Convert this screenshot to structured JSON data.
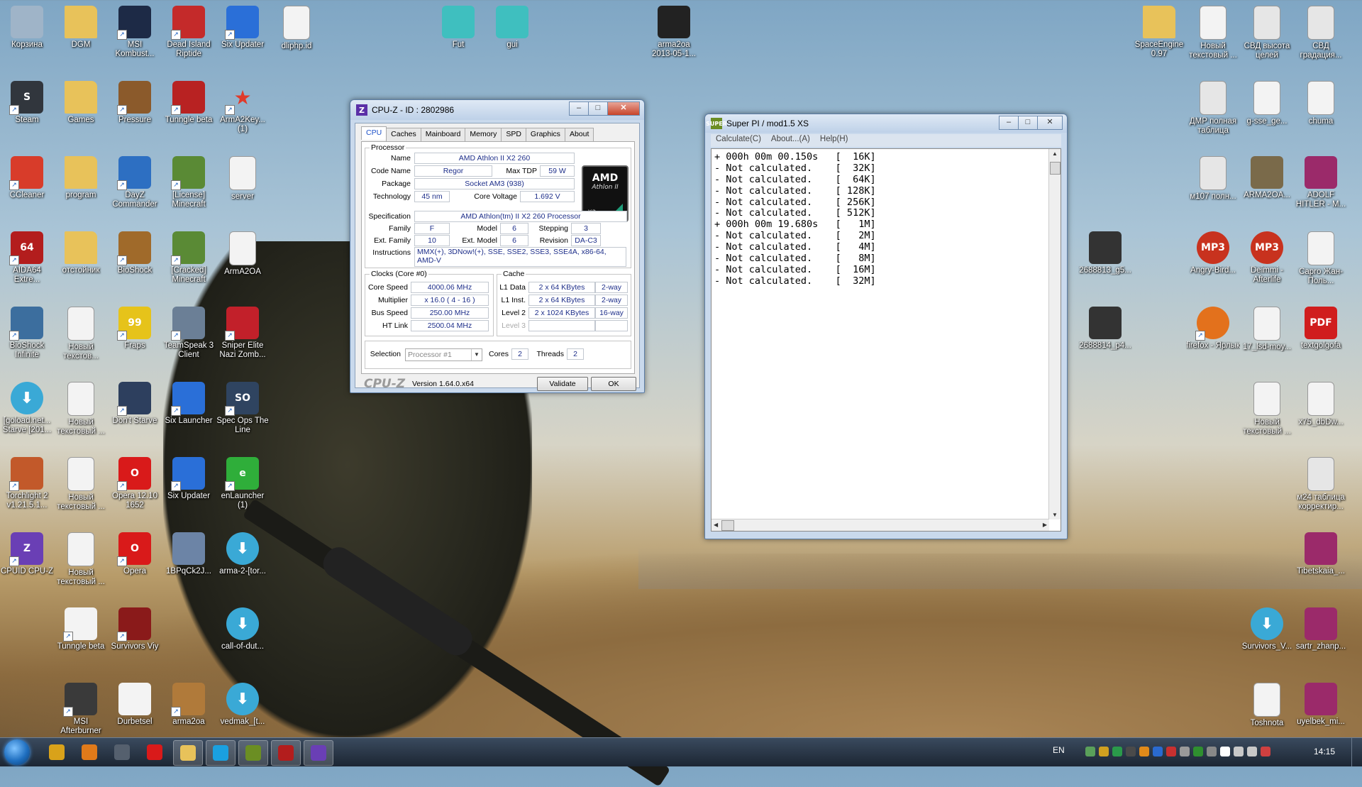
{
  "desktop": {
    "icons": [
      {
        "label": "Корзина",
        "icon": "recycle-bin-icon",
        "color": "#9fb4c8"
      },
      {
        "label": "DGM",
        "icon": "folder-icon",
        "color": "#e8c25a"
      },
      {
        "label": "MSI Kombust...",
        "icon": "msi-kombustor-icon",
        "color": "#1d2a46"
      },
      {
        "label": "Dead Island Riptide",
        "icon": "dead-island-icon",
        "color": "#c42a2a"
      },
      {
        "label": "Six Updater",
        "icon": "six-updater-icon",
        "color": "#2a6fd8"
      },
      {
        "label": "dliphp.id",
        "icon": "document-icon",
        "color": "#f3f3f3"
      },
      {
        "label": "Fut",
        "icon": "blocks-icon",
        "color": "#3fbfbf"
      },
      {
        "label": "gui",
        "icon": "blocks-icon",
        "color": "#3fbfbf"
      },
      {
        "label": "arma2oa 2013-05-1...",
        "icon": "video-thumb-icon",
        "color": "#222"
      },
      {
        "label": "Steam",
        "icon": "steam-icon",
        "color": "#31363d"
      },
      {
        "label": "Games",
        "icon": "folder-icon",
        "color": "#e8c25a"
      },
      {
        "label": "Pressure",
        "icon": "pressure-icon",
        "color": "#8b5a2b"
      },
      {
        "label": "Tunngle beta",
        "icon": "tunngle-icon",
        "color": "#b82222"
      },
      {
        "label": "ArmA2Key... (1)",
        "icon": "star-icon",
        "color": "#e03a2a"
      },
      {
        "label": "CCleaner",
        "icon": "ccleaner-icon",
        "color": "#d83c2a"
      },
      {
        "label": "program",
        "icon": "folder-icon",
        "color": "#e8c25a"
      },
      {
        "label": "DayZ Commander",
        "icon": "dayz-icon",
        "color": "#2d6fc2"
      },
      {
        "label": "[License] Minecraft",
        "icon": "minecraft-icon",
        "color": "#5a8a35"
      },
      {
        "label": "server",
        "icon": "text-file-icon",
        "color": "#f3f3f3"
      },
      {
        "label": "AIDA64 Extre...",
        "icon": "aida64-icon",
        "color": "#b31d1d"
      },
      {
        "label": "отстойник",
        "icon": "folder-icon",
        "color": "#e8c25a"
      },
      {
        "label": "BioShock",
        "icon": "bioshock-icon",
        "color": "#a06a2a"
      },
      {
        "label": "[Cracked] Minecraft",
        "icon": "minecraft-icon",
        "color": "#5a8a35"
      },
      {
        "label": "ArmA2OA",
        "icon": "text-file-icon",
        "color": "#f3f3f3"
      },
      {
        "label": "BioShock Infinite",
        "icon": "bioshock-infinite-icon",
        "color": "#3c6e9e"
      },
      {
        "label": "Новый текстов...",
        "icon": "text-file-icon",
        "color": "#f3f3f3"
      },
      {
        "label": "Fraps",
        "icon": "fraps-icon",
        "color": "#e6c31a"
      },
      {
        "label": "TeamSpeak 3 Client",
        "icon": "teamspeak-icon",
        "color": "#6b7f96"
      },
      {
        "label": "Sniper Elite Nazi Zomb...",
        "icon": "sniper-elite-icon",
        "color": "#c2202a"
      },
      {
        "label": "[goload.net... Starve [201...",
        "icon": "download-icon",
        "color": "#3aa9d6"
      },
      {
        "label": "Новый текстовый ...",
        "icon": "text-file-icon",
        "color": "#f3f3f3"
      },
      {
        "label": "Don't Starve",
        "icon": "dont-starve-icon",
        "color": "#2d3f5e"
      },
      {
        "label": "Six Launcher",
        "icon": "six-launcher-icon",
        "color": "#2a6fd8"
      },
      {
        "label": "Spec Ops The Line",
        "icon": "spec-ops-icon",
        "color": "#2f4460"
      },
      {
        "label": "Torchlight 2 v1.21.5.1...",
        "icon": "torchlight-icon",
        "color": "#c2592a"
      },
      {
        "label": "Новый текстовый ...",
        "icon": "text-file-icon",
        "color": "#f3f3f3"
      },
      {
        "label": "Opera 12.10 1652",
        "icon": "opera-icon",
        "color": "#d91a1a"
      },
      {
        "label": "Six Updater",
        "icon": "six-updater-icon",
        "color": "#2a6fd8"
      },
      {
        "label": "enLauncher (1)",
        "icon": "enlauncher-icon",
        "color": "#2fae3a"
      },
      {
        "label": "CPUID CPU-Z",
        "icon": "cpuz-icon",
        "color": "#6a3fb5"
      },
      {
        "label": "Новый текстовый ...",
        "icon": "text-file-icon",
        "color": "#f3f3f3"
      },
      {
        "label": "Opera",
        "icon": "opera-icon",
        "color": "#d91a1a"
      },
      {
        "label": "1BPqCk2J...",
        "icon": "image-thumb-icon",
        "color": "#6c84a6"
      },
      {
        "label": "arma-2-[tor...",
        "icon": "download-icon",
        "color": "#3aa9d6"
      },
      {
        "label": "Tunngle beta",
        "icon": "calendar-doc-icon",
        "color": "#f3f3f3"
      },
      {
        "label": "Survivors Viy",
        "icon": "survivors-icon",
        "color": "#8a1a1a"
      },
      {
        "label": "call-of-dut...",
        "icon": "download-icon",
        "color": "#3aa9d6"
      },
      {
        "label": "MSI Afterburner",
        "icon": "afterburner-icon",
        "color": "#3a3a3a"
      },
      {
        "label": "Durbetsel",
        "icon": "cards-icon",
        "color": "#f3f3f3"
      },
      {
        "label": "arma2oa",
        "icon": "arma-icon",
        "color": "#b07a3a"
      },
      {
        "label": "vedmak_[t...",
        "icon": "download-icon",
        "color": "#3aa9d6"
      },
      {
        "label": "SpaceEngine 0.97",
        "icon": "folder-icon",
        "color": "#e8c25a"
      },
      {
        "label": "Новый текстовый ...",
        "icon": "text-file-icon",
        "color": "#f3f3f3"
      },
      {
        "label": "СВД высота целей",
        "icon": "table-icon",
        "color": "#e6e6e6"
      },
      {
        "label": "СВД градация...",
        "icon": "table-icon",
        "color": "#e6e6e6"
      },
      {
        "label": "ДМР полная таблица",
        "icon": "table-icon",
        "color": "#e6e6e6"
      },
      {
        "label": "g-sse_ge...",
        "icon": "image-file-icon",
        "color": "#f3f3f3"
      },
      {
        "label": "chuma",
        "icon": "text-file-icon",
        "color": "#f3f3f3"
      },
      {
        "label": "м107 полн...",
        "icon": "table-icon",
        "color": "#e6e6e6"
      },
      {
        "label": "ARMA2OA...",
        "icon": "arma-soldier-icon",
        "color": "#7a6a4a"
      },
      {
        "label": "ADOLF HITLER - M...",
        "icon": "winrar-icon",
        "color": "#9b2a6a"
      },
      {
        "label": "2688813_g5...",
        "icon": "video-thumb-icon",
        "color": "#333"
      },
      {
        "label": "Angry-Bird...",
        "icon": "mp3-icon",
        "color": "#c8321e"
      },
      {
        "label": "Deimmi - Afterlife",
        "icon": "mp3-icon",
        "color": "#c8321e"
      },
      {
        "label": "Capro Жан-Поль...",
        "icon": "image-file-icon",
        "color": "#f3f3f3"
      },
      {
        "label": "2688814_p4...",
        "icon": "video-thumb-icon",
        "color": "#333"
      },
      {
        "label": "firefox - Ярлык",
        "icon": "firefox-icon",
        "color": "#e3711c"
      },
      {
        "label": "17_lsd-moy...",
        "icon": "image-file-icon",
        "color": "#f3f3f3"
      },
      {
        "label": "textgolgofa",
        "icon": "pdf-icon",
        "color": "#d01d1d"
      },
      {
        "label": "Новый текстовый ...",
        "icon": "text-file-icon",
        "color": "#f3f3f3"
      },
      {
        "label": "x75_dbDw...",
        "icon": "document-icon",
        "color": "#f3f3f3"
      },
      {
        "label": "м24 таблица корректир...",
        "icon": "table-icon",
        "color": "#e6e6e6"
      },
      {
        "label": "Tibetskaia_...",
        "icon": "winrar-icon",
        "color": "#9b2a6a"
      },
      {
        "label": "Survivors_V...",
        "icon": "download-icon",
        "color": "#3aa9d6"
      },
      {
        "label": "sartr_zhanp...",
        "icon": "winrar-icon",
        "color": "#9b2a6a"
      },
      {
        "label": "Toshnota",
        "icon": "document-icon",
        "color": "#f3f3f3"
      },
      {
        "label": "uyelbek_mi...",
        "icon": "winrar-icon",
        "color": "#9b2a6a"
      }
    ]
  },
  "cpuz": {
    "title": "CPU-Z - ID : 2802986",
    "tabs": [
      "CPU",
      "Caches",
      "Mainboard",
      "Memory",
      "SPD",
      "Graphics",
      "About"
    ],
    "processor_group": "Processor",
    "labels": {
      "name": "Name",
      "codename": "Code Name",
      "maxtdp": "Max TDP",
      "package": "Package",
      "technology": "Technology",
      "corevoltage": "Core Voltage",
      "specification": "Specification",
      "family": "Family",
      "model": "Model",
      "stepping": "Stepping",
      "extfamily": "Ext. Family",
      "extmodel": "Ext. Model",
      "revision": "Revision",
      "instructions": "Instructions"
    },
    "values": {
      "name": "AMD Athlon II X2 260",
      "codename": "Regor",
      "maxtdp": "59 W",
      "package": "Socket AM3 (938)",
      "technology": "45 nm",
      "corevoltage": "1.692 V",
      "specification": "AMD Athlon(tm) II X2 260 Processor",
      "family": "F",
      "model": "6",
      "stepping": "3",
      "extfamily": "10",
      "extmodel": "6",
      "revision": "DA-C3",
      "instructions_1": "MMX(+), 3DNow!(+), SSE, SSE2, SSE3, SSE4A, x86-64,",
      "instructions_2": "AMD-V"
    },
    "logo": {
      "brand": "AMD",
      "line": "Athlon II",
      "tag": "X2"
    },
    "clocks_group": "Clocks (Core #0)",
    "clocks": {
      "corespeed_label": "Core Speed",
      "corespeed": "4000.06 MHz",
      "multiplier_label": "Multiplier",
      "multiplier": "x 16.0 ( 4 - 16 )",
      "busspeed_label": "Bus Speed",
      "busspeed": "250.00 MHz",
      "htlink_label": "HT Link",
      "htlink": "2500.04 MHz"
    },
    "cache_group": "Cache",
    "cache": {
      "l1d_label": "L1 Data",
      "l1d": "2 x 64 KBytes",
      "l1d_way": "2-way",
      "l1i_label": "L1 Inst.",
      "l1i": "2 x 64 KBytes",
      "l1i_way": "2-way",
      "l2_label": "Level 2",
      "l2": "2 x 1024 KBytes",
      "l2_way": "16-way",
      "l3_label": "Level 3"
    },
    "selection_label": "Selection",
    "selection_value": "Processor #1",
    "cores_label": "Cores",
    "cores": "2",
    "threads_label": "Threads",
    "threads": "2",
    "brand": "CPU-Z",
    "version": "Version 1.64.0.x64",
    "validate": "Validate",
    "ok": "OK"
  },
  "superpi": {
    "title": "Super PI / mod1.5 XS",
    "menu": [
      "Calculate(C)",
      "About...(A)",
      "Help(H)"
    ],
    "lines": [
      "+ 000h 00m 00.150s   [  16K]",
      "- Not calculated.    [  32K]",
      "- Not calculated.    [  64K]",
      "- Not calculated.    [ 128K]",
      "- Not calculated.    [ 256K]",
      "- Not calculated.    [ 512K]",
      "+ 000h 00m 19.680s   [   1M]",
      "- Not calculated.    [   2M]",
      "- Not calculated.    [   4M]",
      "- Not calculated.    [   8M]",
      "- Not calculated.    [  16M]",
      "- Not calculated.    [  32M]"
    ]
  },
  "taskbar": {
    "items": [
      {
        "icon": "chrome-icon",
        "color": "#d9a21a"
      },
      {
        "icon": "media-player-icon",
        "color": "#e07a1a"
      },
      {
        "icon": "dayz-launcher-icon",
        "color": "#55606e"
      },
      {
        "icon": "opera-icon",
        "color": "#d91a1a"
      },
      {
        "icon": "explorer-icon",
        "color": "#e8c25a"
      },
      {
        "icon": "skype-icon",
        "color": "#1aa0e0"
      },
      {
        "icon": "superpi-icon",
        "color": "#6b8e23"
      },
      {
        "icon": "aida64-icon",
        "color": "#b31d1d"
      },
      {
        "icon": "cpuz-icon",
        "color": "#6a3fb5"
      }
    ],
    "lang": "EN",
    "tray_colors": [
      "#5aa05a",
      "#d0a020",
      "#2a9a4a",
      "#4a4a4a",
      "#e08a1a",
      "#2a6ad0",
      "#c83030",
      "#9a9a9a",
      "#2f8f2f",
      "#888",
      "#fff",
      "#c8c8c8",
      "#c8c8c8",
      "#d04040"
    ],
    "clock": "14:15"
  }
}
